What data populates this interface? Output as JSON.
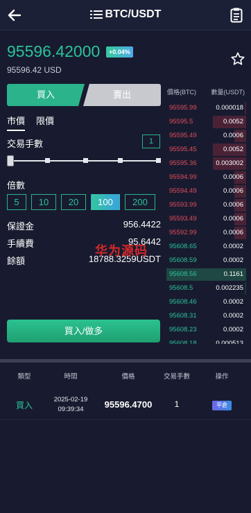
{
  "header": {
    "title": "BTC/USDT",
    "back_icon": "arrow-left-icon",
    "menu_icon": "list-icon",
    "orders_icon": "document-icon"
  },
  "ticker": {
    "price": "95596.42000",
    "change": "+0.04%",
    "price_usd": "95596.42 USD",
    "favorite_icon": "star-outline-icon",
    "price_color": "#2bc39a"
  },
  "trade_tabs": {
    "buy": "買入",
    "sell": "賣出"
  },
  "order_types": {
    "market": "市價",
    "limit": "限價"
  },
  "quantity": {
    "label": "交易手數",
    "value": "1",
    "slider_level": 0
  },
  "leverage": {
    "label": "倍數",
    "options": [
      "5",
      "10",
      "20",
      "100",
      "200"
    ],
    "selected": "100"
  },
  "summary": {
    "margin_label": "保證金",
    "margin_value": "956.4422",
    "fee_label": "手續費",
    "fee_value": "95.6442",
    "balance_label": "餘額",
    "balance_value": "18788.3259USDT"
  },
  "watermark": "华为源码",
  "submit": {
    "label": "買入/做多"
  },
  "orderbook": {
    "price_header": "價格(BTC)",
    "qty_header": "數量(USDT)",
    "asks": [
      {
        "price": "95595.99",
        "qty": "0.000018",
        "depth": 0.05
      },
      {
        "price": "95595.5",
        "qty": "0.0052",
        "depth": 1.0
      },
      {
        "price": "95595.49",
        "qty": "0.0006",
        "depth": 0.35
      },
      {
        "price": "95595.45",
        "qty": "0.0052",
        "depth": 1.0
      },
      {
        "price": "95595.36",
        "qty": "0.003002",
        "depth": 1.0
      },
      {
        "price": "95594.99",
        "qty": "0.0006",
        "depth": 0.35
      },
      {
        "price": "95594.49",
        "qty": "0.0006",
        "depth": 0.35
      },
      {
        "price": "95593.99",
        "qty": "0.0006",
        "depth": 0.35
      },
      {
        "price": "95593.49",
        "qty": "0.0006",
        "depth": 0.35
      },
      {
        "price": "95592.99",
        "qty": "0.0006",
        "depth": 0.35
      }
    ],
    "bids": [
      {
        "price": "95608.65",
        "qty": "0.0002",
        "depth": 0.0
      },
      {
        "price": "95608.59",
        "qty": "0.0002",
        "depth": 0.0
      },
      {
        "price": "95608.56",
        "qty": "0.1161",
        "depth": 1.0,
        "highlight": true
      },
      {
        "price": "95608.5",
        "qty": "0.002235",
        "depth": 0.05
      },
      {
        "price": "95608.46",
        "qty": "0.0002",
        "depth": 0.0
      },
      {
        "price": "95608.31",
        "qty": "0.0002",
        "depth": 0.0
      },
      {
        "price": "95608.23",
        "qty": "0.0002",
        "depth": 0.0
      },
      {
        "price": "95608.18",
        "qty": "0.000513",
        "depth": 0.0
      }
    ]
  },
  "orders_table": {
    "headers": [
      "類型",
      "時間",
      "價格",
      "交易手數",
      "操作"
    ],
    "rows": [
      {
        "type": "買入",
        "date": "2025-02-19",
        "time": "09:39:34",
        "price": "95596.4700",
        "qty": "1",
        "action": "平倉"
      }
    ]
  }
}
